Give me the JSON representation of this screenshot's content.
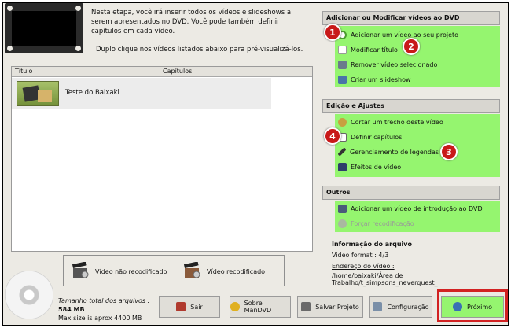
{
  "header": {
    "intro_line1": "Nesta etapa, você irá inserir todos os vídeos e slideshows a serem apresentados no DVD. Você pode também definir capítulos em cada vídeo.",
    "intro_line2": "Duplo clique nos vídeos listados abaixo para pré-visualizá-los."
  },
  "table": {
    "columns": [
      "Título",
      "Capítulos"
    ],
    "rows": [
      {
        "title": "Teste do Baixaki",
        "chapters": ""
      }
    ]
  },
  "legend": {
    "not_recoded": "Vídeo não recodificado",
    "recoded": "Vídeo recodificado"
  },
  "sections": {
    "add_modify": {
      "title": "Adicionar ou Modificar vídeos ao DVD",
      "items": [
        "Adicionar um vídeo ao seu projeto",
        "Modificar título",
        "Remover vídeo selecionado",
        "Criar um slideshow"
      ]
    },
    "edit": {
      "title": "Edição e Ajustes",
      "items": [
        "Cortar um trecho deste vídeo",
        "Definir capítulos",
        "Gerenciamento de legendas",
        "Efeitos de vídeo"
      ]
    },
    "others": {
      "title": "Outros",
      "items": [
        "Adicionar um vídeo de introdução ao DVD",
        "Forçar recodificação"
      ]
    }
  },
  "badges": [
    "1",
    "2",
    "3",
    "4"
  ],
  "file_info": {
    "title": "Informação do arquivo",
    "format": "Video format : 4/3",
    "address_label": "Endereço do vídeo :",
    "address": "/home/baixaki/Área de Trabalho/t_simpsons_neverquest_"
  },
  "footer": {
    "total_label": "Tamanho total dos arquivos :",
    "total_value": "584 MB",
    "max_size": "Max size is aprox 4400 MB"
  },
  "buttons": {
    "exit": "Sair",
    "about": "Sobre ManDVD",
    "save": "Salvar Projeto",
    "config": "Configuração",
    "next": "Próximo"
  },
  "colors": {
    "section_green": "#95f56f",
    "badge_red": "#c81919",
    "highlight_red": "#d22222"
  }
}
